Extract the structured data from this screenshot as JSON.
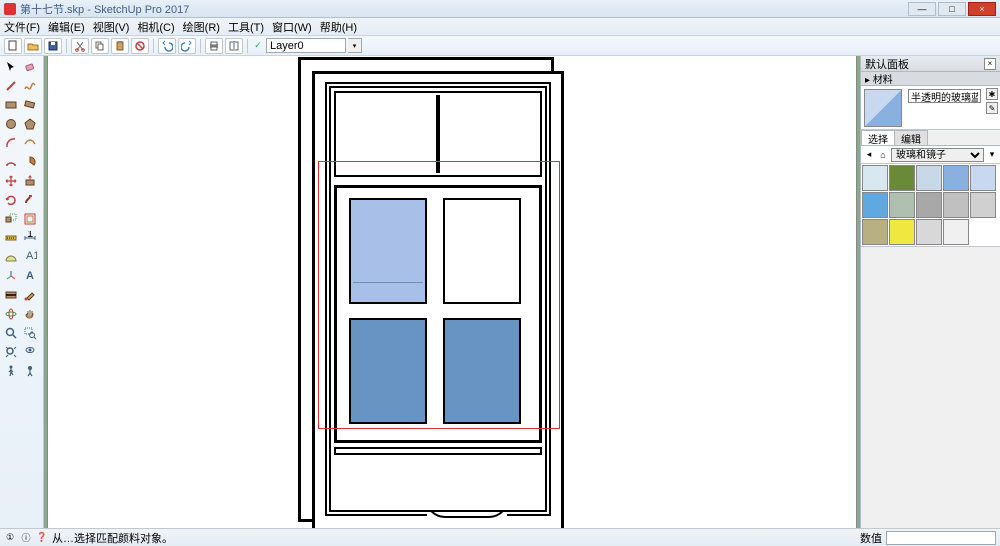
{
  "app": {
    "title": "第十七节.skp - SketchUp Pro 2017",
    "win_min": "—",
    "win_max": "□",
    "win_close": "×"
  },
  "menu": {
    "file": "文件(F)",
    "edit": "编辑(E)",
    "view": "视图(V)",
    "camera": "相机(C)",
    "draw": "绘图(R)",
    "tools": "工具(T)",
    "window": "窗口(W)",
    "help": "帮助(H)"
  },
  "layer": {
    "check": "✓",
    "name": "Layer0",
    "drop": "▾"
  },
  "panel": {
    "default_tray": "默认面板",
    "close": "×",
    "materials": "▸ 材料",
    "material_name": "半透明的玻璃蓝",
    "tab_select": "选择",
    "tab_edit": "编辑",
    "dropdown": "玻璃和镜子",
    "back": "◂",
    "home": "⌂"
  },
  "swatches": [
    "#d8e8f0",
    "#6a8a3a",
    "#c8d8e8",
    "#8ab0e0",
    "#c8d8f0",
    "#60a8e0",
    "#b0c0b0",
    "#a8a8a8",
    "#c0c0c0",
    "#d0d0d0",
    "#b8b080",
    "#f0e840",
    "#d8d8d8",
    "#f0f0f0"
  ],
  "status": {
    "icon1": "①",
    "icon2": "ⓘ",
    "icon3": "❓",
    "message": "从…选择匹配颜料对象。",
    "value_label": "数值",
    "value": ""
  }
}
